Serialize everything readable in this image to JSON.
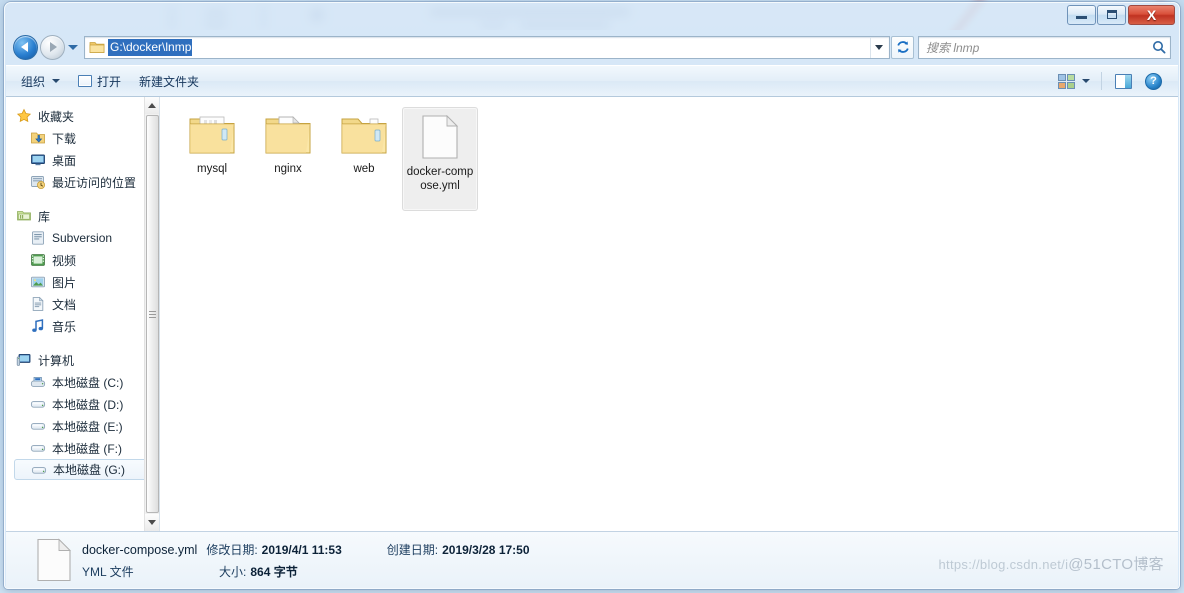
{
  "window": {
    "controls": {
      "minimize": "—",
      "maximize": "□",
      "close": "X"
    }
  },
  "nav": {
    "back_label": "后退",
    "forward_label": "前进",
    "recent_label": "最近浏览的位置",
    "address_value": "G:\\docker\\lnmp",
    "address_dropdown": "▼",
    "refresh_label": "刷新",
    "refresh_glyph": "↻",
    "search_placeholder": "搜索 lnmp",
    "search_icon": "⌕"
  },
  "toolbar": {
    "organize_label": "组织",
    "open_label": "打开",
    "new_folder_label": "新建文件夹",
    "view_label": "更改您的视图",
    "preview_label": "显示预览窗格",
    "help_label": "获取帮助",
    "help_glyph": "?"
  },
  "sidebar": {
    "groups": [
      {
        "name": "favorites",
        "root": {
          "label": "收藏夹",
          "icon": "star-icon"
        },
        "items": [
          {
            "label": "下载",
            "icon": "downloads-icon"
          },
          {
            "label": "桌面",
            "icon": "desktop-icon"
          },
          {
            "label": "最近访问的位置",
            "icon": "recent-places-icon"
          }
        ]
      },
      {
        "name": "libraries",
        "root": {
          "label": "库",
          "icon": "library-icon"
        },
        "items": [
          {
            "label": "Subversion",
            "icon": "subversion-icon"
          },
          {
            "label": "视频",
            "icon": "videos-icon"
          },
          {
            "label": "图片",
            "icon": "pictures-icon"
          },
          {
            "label": "文档",
            "icon": "documents-icon"
          },
          {
            "label": "音乐",
            "icon": "music-icon"
          }
        ]
      },
      {
        "name": "computer",
        "root": {
          "label": "计算机",
          "icon": "computer-icon"
        },
        "items": [
          {
            "label": "本地磁盘 (C:)",
            "icon": "system-drive-icon",
            "selected": false
          },
          {
            "label": "本地磁盘 (D:)",
            "icon": "drive-icon",
            "selected": false
          },
          {
            "label": "本地磁盘 (E:)",
            "icon": "drive-icon",
            "selected": false
          },
          {
            "label": "本地磁盘 (F:)",
            "icon": "drive-icon",
            "selected": false
          },
          {
            "label": "本地磁盘 (G:)",
            "icon": "drive-icon",
            "selected": true
          }
        ]
      }
    ]
  },
  "files": [
    {
      "name": "mysql",
      "type": "folder",
      "selected": false
    },
    {
      "name": "nginx",
      "type": "folder",
      "selected": false
    },
    {
      "name": "web",
      "type": "folder",
      "selected": false
    },
    {
      "name": "docker-compose.yml",
      "type": "file",
      "selected": true
    }
  ],
  "status": {
    "file_name": "docker-compose.yml",
    "modified_key": "修改日期:",
    "modified_value": "2019/4/1 11:53",
    "created_key": "创建日期:",
    "created_value": "2019/3/28 17:50",
    "file_type": "YML 文件",
    "size_key": "大小:",
    "size_value": "864 字节"
  },
  "watermark": {
    "url": "https://blog.csdn.net/i",
    "site": "@51CTO博客"
  },
  "colors": {
    "accent": "#2f6fbe",
    "close_button": "#c03221",
    "folder": "#f5d97a",
    "selection": "#eeeeee"
  }
}
